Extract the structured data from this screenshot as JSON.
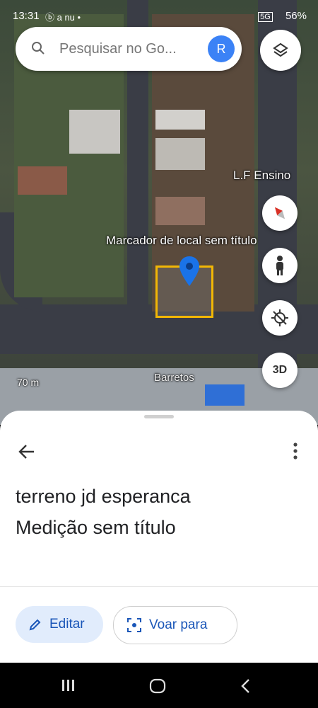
{
  "status_bar": {
    "time": "13:31",
    "icons_text": "ⓑ a nu •",
    "network": "5G",
    "battery": "56%"
  },
  "search": {
    "placeholder": "Pesquisar no Go...",
    "avatar_letter": "R"
  },
  "map": {
    "poi_label": "L.F Ensino",
    "marker_label": "Marcador de local sem título",
    "scale_label": "70 m",
    "watermark": "Barretos",
    "button_3d": "3D"
  },
  "sheet": {
    "title": "terreno jd esperanca",
    "subtitle": "Medição sem título",
    "edit_label": "Editar",
    "fly_label": "Voar para"
  },
  "colors": {
    "accent": "#1a73e8",
    "selection_outline": "#f2b705",
    "marker": "#1a73e8"
  }
}
